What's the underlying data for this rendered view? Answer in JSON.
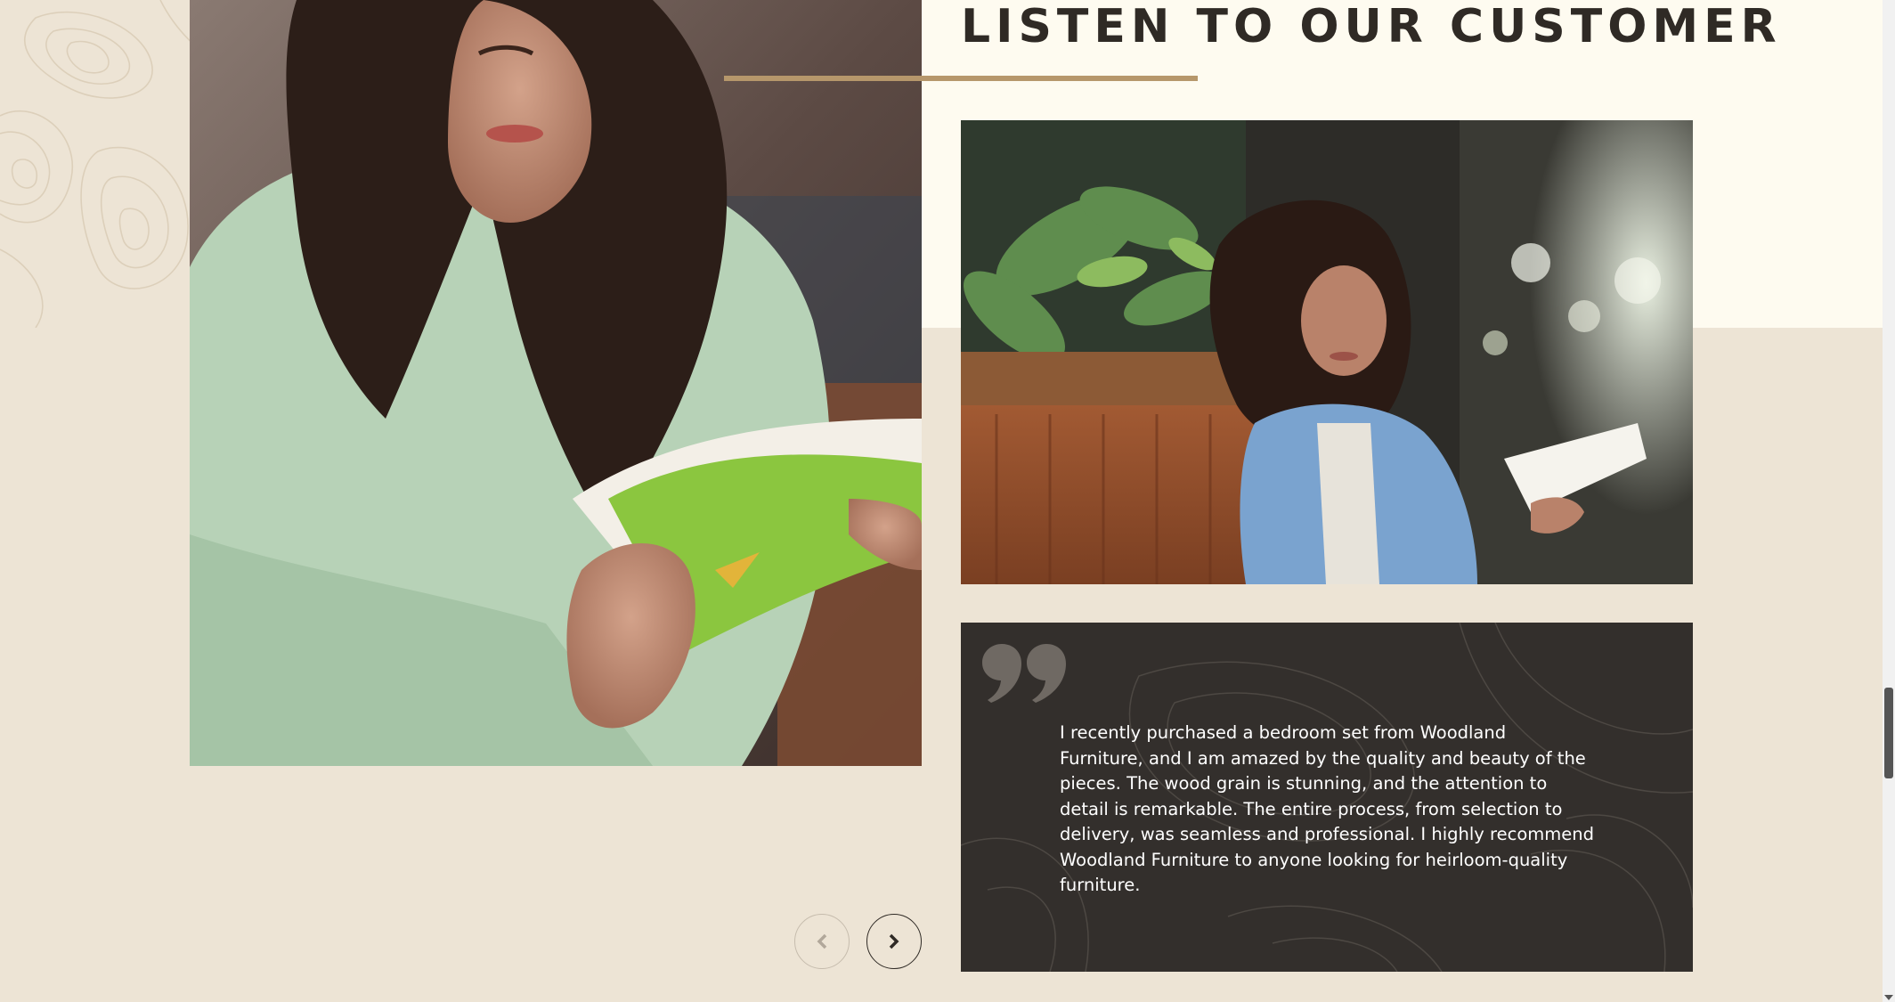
{
  "section": {
    "title": "LISTEN TO OUR CUSTOMER"
  },
  "testimonial": {
    "quote_icon": "quote-icon",
    "text": "I recently purchased a bedroom set from Woodland Furniture, and I am amazed by the quality and beauty of the pieces. The wood grain is stunning, and the attention to detail is remarkable. The entire process, from selection to delivery, was seamless and professional. I highly recommend Woodland Furniture to anyone looking for heirloom-quality furniture."
  },
  "images": {
    "left": "woman-reading-book-photo",
    "right": "woman-in-denim-jacket-photo"
  },
  "carousel": {
    "prev_icon": "chevron-left-icon",
    "next_icon": "chevron-right-icon"
  },
  "colors": {
    "page_bg": "#ede4d5",
    "top_band": "#fefbf0",
    "title_text": "#2f2a25",
    "accent_underline": "#b6976b",
    "quote_card_bg": "#332f2c",
    "quote_text": "#ffffff"
  }
}
